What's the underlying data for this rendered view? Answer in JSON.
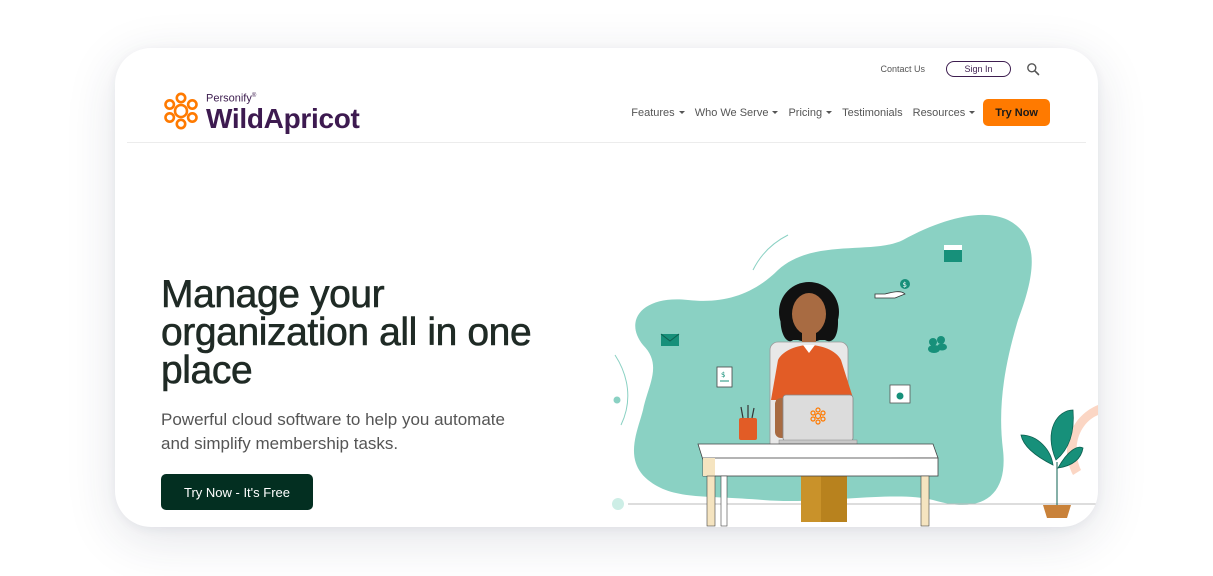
{
  "header": {
    "brand_top": "Personify",
    "brand_main": "WildApricot",
    "contact_label": "Contact Us",
    "signin_label": "Sign In",
    "search_icon": "search-icon",
    "nav": [
      {
        "label": "Features",
        "dropdown": true
      },
      {
        "label": "Who We Serve",
        "dropdown": true
      },
      {
        "label": "Pricing",
        "dropdown": true
      },
      {
        "label": "Testimonials",
        "dropdown": false
      },
      {
        "label": "Resources",
        "dropdown": true
      }
    ],
    "try_now_label": "Try Now"
  },
  "hero": {
    "title_line1": "Manage your",
    "title_line2": "organization all in one",
    "title_line3": "place",
    "subtitle_line1": "Powerful cloud software to help you automate",
    "subtitle_line2": "and simplify membership tasks.",
    "cta_label": "Try Now - It's Free"
  },
  "illustration": {
    "description": "woman at desk with laptop",
    "icons": [
      "mail-icon",
      "invoice-icon",
      "donation-hand-icon",
      "calendar-icon",
      "members-icon",
      "settings-window-icon"
    ]
  },
  "colors": {
    "brand_orange": "#ff7a00",
    "brand_purple": "#3d1a50",
    "cta_green": "#032f21",
    "blob_teal": "#8ad1c3"
  }
}
